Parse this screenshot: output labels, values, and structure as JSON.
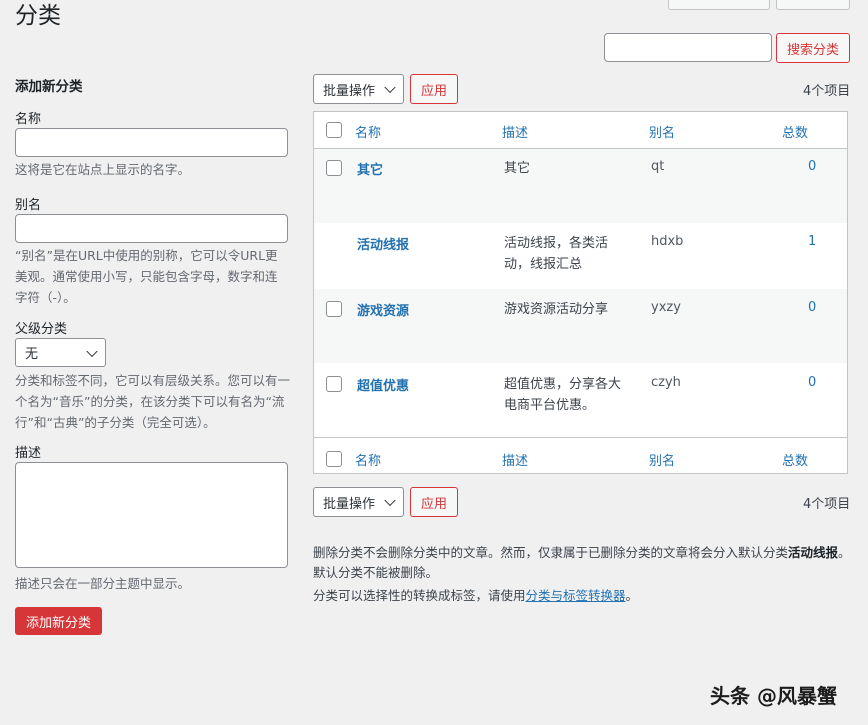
{
  "page": {
    "title": "分类"
  },
  "search": {
    "button_label": "搜索分类",
    "value": ""
  },
  "add_form": {
    "heading": "添加新分类",
    "name_label": "名称",
    "name_help": "这将是它在站点上显示的名字。",
    "slug_label": "别名",
    "slug_help": "“别名”是在URL中使用的别称，它可以令URL更美观。通常使用小写，只能包含字母，数字和连字符（-）。",
    "parent_label": "父级分类",
    "parent_selected": "无",
    "parent_help": "分类和标签不同，它可以有层级关系。您可以有一个名为“音乐”的分类，在该分类下可以有名为“流行”和“古典”的子分类（完全可选）。",
    "desc_label": "描述",
    "desc_help": "描述只会在一部分主题中显示。",
    "submit_label": "添加新分类"
  },
  "bulk": {
    "select_label": "批量操作",
    "apply_label": "应用",
    "items_count": "4个项目"
  },
  "table": {
    "headers": {
      "name": "名称",
      "desc": "描述",
      "slug": "别名",
      "count": "总数"
    },
    "rows": [
      {
        "name": "其它",
        "desc": "其它",
        "slug": "qt",
        "count": "0"
      },
      {
        "name": "活动线报",
        "desc": "活动线报，各类活动，线报汇总",
        "slug": "hdxb",
        "count": "1"
      },
      {
        "name": "游戏资源",
        "desc": "游戏资源活动分享",
        "slug": "yxzy",
        "count": "0"
      },
      {
        "name": "超值优惠",
        "desc": "超值优惠，分享各大电商平台优惠。",
        "slug": "czyh",
        "count": "0"
      }
    ]
  },
  "notes": {
    "line1_prefix": "删除分类不会删除分类中的文章。然而，仅隶属于已删除分类的文章将会分入默认分类",
    "line1_bold": "活动线报",
    "line1_suffix": "。默认分类不能被删除。",
    "line2_prefix": "分类可以选择性的转换成标签，请使用",
    "line2_link": "分类与标签转换器",
    "line2_suffix": "。"
  },
  "watermark": "头条 @风暴蟹"
}
